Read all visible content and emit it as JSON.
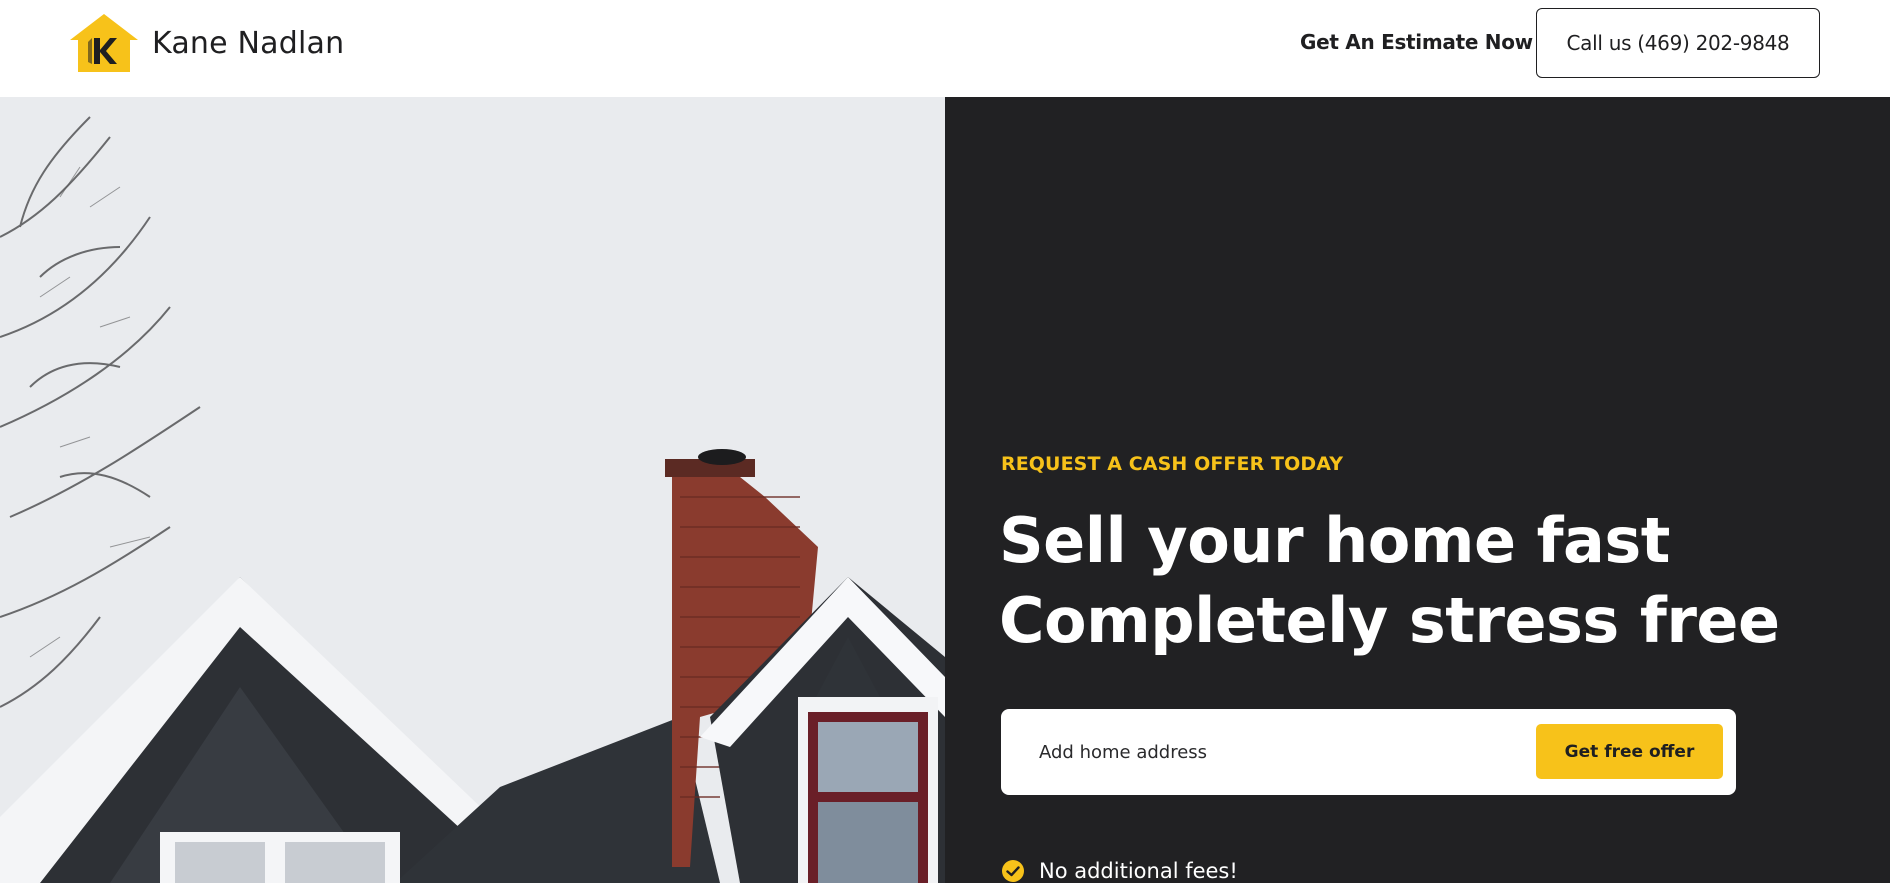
{
  "header": {
    "brand": "Kane Nadlan",
    "logo_icon": "house-k-logo-icon",
    "estimate_link": "Get An Estimate Now",
    "call_button": "Call us (469) 202-9848"
  },
  "hero": {
    "image_description_icon": "house-roof-photo",
    "eyebrow": "REQUEST A CASH OFFER TODAY",
    "headline_line1": "Sell your home fast",
    "headline_line2": "Completely stress free",
    "form": {
      "address_placeholder": "Add home address",
      "address_value": "",
      "submit_label": "Get free offer"
    },
    "benefits": [
      {
        "icon": "check-circle-icon",
        "text": "No additional fees!"
      }
    ]
  },
  "colors": {
    "accent": "#f7c21a",
    "dark_panel": "#212123",
    "text_dark": "#1f1f21",
    "white": "#ffffff"
  }
}
